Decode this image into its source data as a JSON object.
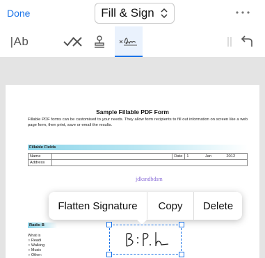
{
  "topbar": {
    "done_label": "Done",
    "mode_label": "Fill & Sign",
    "accent": "#1a73e8"
  },
  "toolbar": {
    "text_tool_label": "|Ab",
    "tools": [
      "add-text",
      "checkmark",
      "cross",
      "stamp",
      "signature"
    ],
    "active_tool": "signature"
  },
  "document": {
    "title": "Sample Fillable PDF Form",
    "description": "Fillable PDF forms can be customised to your needs. They allow form recipients to fill out information on screen like a web page form, then print, save or email the results.",
    "fields_header": "Fillable Fields",
    "name_label": "Name",
    "address_label": "Address",
    "date_label": "Date",
    "date_day": "1",
    "date_month": "Jan",
    "date_year": "2012",
    "typed_text": "jdksndbdsm",
    "radio_header": "Radio B",
    "radio_question": "What is",
    "radio_options": [
      "Readi",
      "Walking",
      "Music",
      "Other:"
    ]
  },
  "context_menu": {
    "flatten_label": "Flatten Signature",
    "copy_label": "Copy",
    "delete_label": "Delete"
  }
}
